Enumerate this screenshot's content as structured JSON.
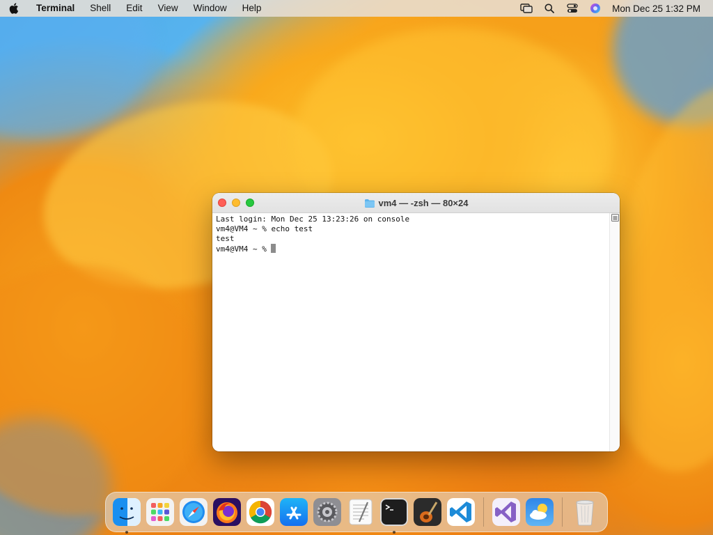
{
  "menubar": {
    "app_name": "Terminal",
    "menus": [
      "Shell",
      "Edit",
      "View",
      "Window",
      "Help"
    ],
    "clock": "Mon Dec 25  1:32 PM",
    "status_icons": [
      "screen-mirroring-icon",
      "spotlight-search-icon",
      "control-center-icon",
      "siri-icon"
    ]
  },
  "window": {
    "title": "vm4 — -zsh — 80×24",
    "lines": [
      "Last login: Mon Dec 25 13:23:26 on console",
      "vm4@VM4 ~ % echo test",
      "test",
      "vm4@VM4 ~ % "
    ]
  },
  "dock": {
    "apps": [
      {
        "name": "Finder",
        "icon": "finder-icon",
        "running": true
      },
      {
        "name": "Launchpad",
        "icon": "launchpad-icon",
        "running": false
      },
      {
        "name": "Safari",
        "icon": "safari-icon",
        "running": false
      },
      {
        "name": "Firefox",
        "icon": "firefox-icon",
        "running": false
      },
      {
        "name": "Chrome",
        "icon": "chrome-icon",
        "running": false
      },
      {
        "name": "App Store",
        "icon": "app-store-icon",
        "running": false
      },
      {
        "name": "System Settings",
        "icon": "system-settings-icon",
        "running": false
      },
      {
        "name": "TextEdit",
        "icon": "textedit-icon",
        "running": false
      },
      {
        "name": "Terminal",
        "icon": "terminal-icon",
        "running": true
      },
      {
        "name": "GarageBand",
        "icon": "garageband-icon",
        "running": false
      },
      {
        "name": "Visual Studio Code",
        "icon": "vscode-icon",
        "running": false
      },
      {
        "name": "Visual Studio",
        "icon": "visual-studio-icon",
        "running": false
      },
      {
        "name": "Weather",
        "icon": "weather-icon",
        "running": false
      },
      {
        "name": "Trash",
        "icon": "trash-icon",
        "running": false
      }
    ]
  },
  "colors": {
    "close": "#ff5f57",
    "minimize": "#febc2e",
    "maximize": "#28c840"
  }
}
